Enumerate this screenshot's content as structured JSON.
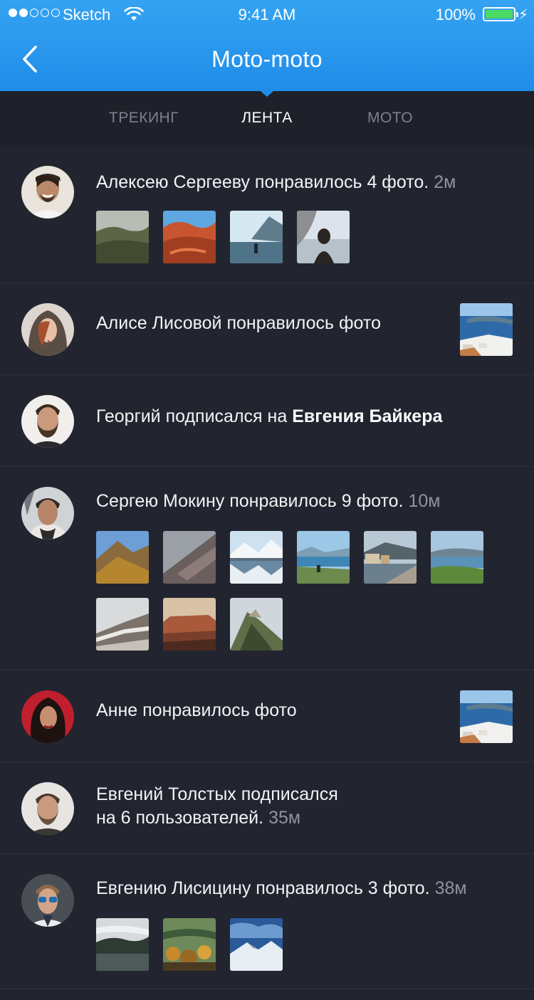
{
  "status_bar": {
    "carrier": "Sketch",
    "time": "9:41 AM",
    "battery": "100%"
  },
  "header": {
    "title": "Moto-moto"
  },
  "tabs": [
    {
      "label": "ТРЕКИНГ",
      "active": false
    },
    {
      "label": "ЛЕНТА",
      "active": true
    },
    {
      "label": "МОТО",
      "active": false
    }
  ],
  "feed": [
    {
      "text": "Алексею Сергееву понравилось 4 фото.",
      "time": "2м",
      "avatar": "avatar-male-smiling",
      "photos": [
        "photo-valley",
        "photo-red-rocks",
        "photo-lake-person",
        "photo-beach-girl"
      ]
    },
    {
      "text": "Алисе Лисовой понравилось фото",
      "avatar": "avatar-female-hood",
      "side_photo": "photo-santorini"
    },
    {
      "text_prefix": "Георгий подписался на ",
      "text_bold": "Евгения Байкера",
      "avatar": "avatar-male-beard"
    },
    {
      "text": "Сергею Мокину понравилось 9 фото.",
      "time": "10м",
      "avatar": "avatar-male-scarf",
      "photos": [
        "photo-ridge",
        "photo-mist-slope",
        "photo-snow-lake",
        "photo-mountain-view",
        "photo-harbor",
        "photo-green-lake",
        "photo-snow-cliff",
        "photo-canyon",
        "photo-peak"
      ]
    },
    {
      "text": "Анне понравилось фото",
      "avatar": "avatar-female-red",
      "side_photo": "photo-santorini"
    },
    {
      "text_line1": "Евгений Толстых подписался",
      "text_line2": "на 6 пользователей.",
      "time": "35м",
      "avatar": "avatar-male-stubble"
    },
    {
      "text": "Евгению Лисицину понравилось 3 фото.",
      "time": "38м",
      "avatar": "avatar-male-sunglasses",
      "photos": [
        "photo-fog-lake",
        "photo-autumn-forest",
        "photo-snow-mountain"
      ]
    }
  ],
  "colors": {
    "header_top": "#35a3f1",
    "header_bottom": "#1f8de9",
    "background": "#22252f",
    "tabbar": "#1e2129",
    "muted_text": "#8e939e"
  }
}
